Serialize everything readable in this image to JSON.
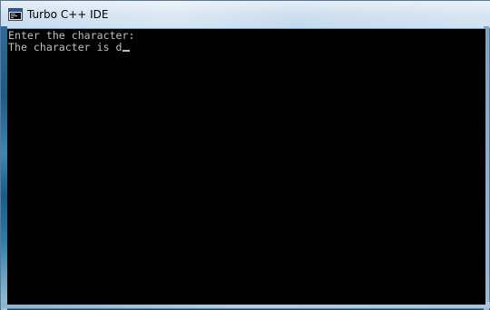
{
  "window": {
    "title": "Turbo C++ IDE",
    "icon": "console-window-icon"
  },
  "console": {
    "lines": [
      "Enter the character:",
      "The character is d"
    ],
    "cursor_after_line": 2,
    "text_color": "#c0c0c0",
    "background_color": "#000000"
  }
}
